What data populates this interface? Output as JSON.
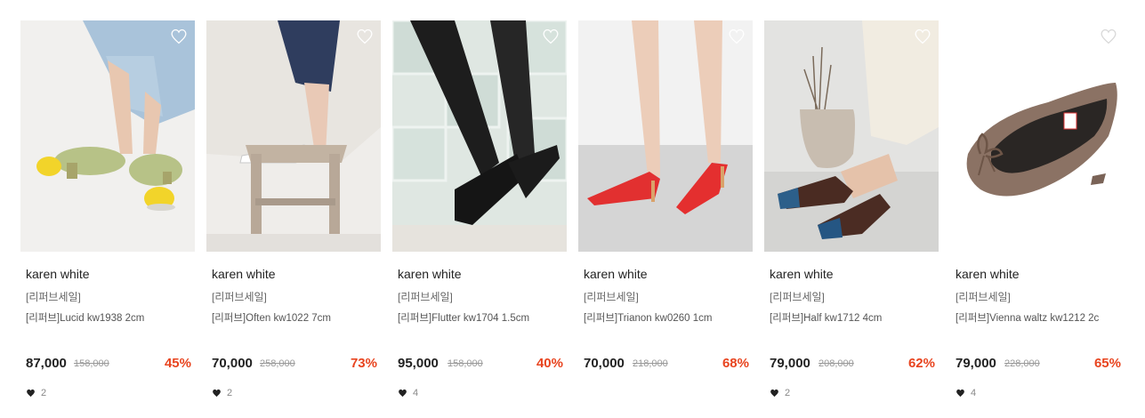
{
  "products": [
    {
      "brand": "karen white",
      "tag": "[리퍼브세일]",
      "name": "[리퍼브]Lucid kw1938 2cm",
      "price": "87,000",
      "original_price": "158,000",
      "discount": "45%",
      "likes": "2",
      "image_theme": "green-lace-shoes-lemons",
      "heart_icon": "heart-outline-icon"
    },
    {
      "brand": "karen white",
      "tag": "[리퍼브세일]",
      "name": "[리퍼브]Often kw1022 7cm",
      "price": "70,000",
      "original_price": "258,000",
      "discount": "73%",
      "likes": "2",
      "image_theme": "white-slingback-heel-stool",
      "heart_icon": "heart-outline-icon"
    },
    {
      "brand": "karen white",
      "tag": "[리퍼브세일]",
      "name": "[리퍼브]Flutter kw1704 1.5cm",
      "price": "95,000",
      "original_price": "158,000",
      "discount": "40%",
      "likes": "4",
      "image_theme": "black-flats-glass-block",
      "heart_icon": "heart-outline-icon"
    },
    {
      "brand": "karen white",
      "tag": "[리퍼브세일]",
      "name": "[리퍼브]Trianon kw0260 1cm",
      "price": "70,000",
      "original_price": "218,000",
      "discount": "68%",
      "likes": "",
      "image_theme": "red-ankle-strap-flats",
      "heart_icon": "heart-outline-icon"
    },
    {
      "brand": "karen white",
      "tag": "[리퍼브세일]",
      "name": "[리퍼브]Half kw1712 4cm",
      "price": "79,000",
      "original_price": "208,000",
      "discount": "62%",
      "likes": "2",
      "image_theme": "brown-blue-toe-slingbacks",
      "heart_icon": "heart-outline-icon"
    },
    {
      "brand": "karen white",
      "tag": "[리퍼브세일]",
      "name": "[리퍼브]Vienna waltz kw1212 2c",
      "price": "79,000",
      "original_price": "228,000",
      "discount": "65%",
      "likes": "4",
      "image_theme": "taupe-bow-ballet-flat",
      "heart_icon": "heart-outline-icon"
    }
  ],
  "colors": {
    "discount": "#e8441f",
    "price": "#222222",
    "original_price": "#999999",
    "likes": "#888888"
  }
}
